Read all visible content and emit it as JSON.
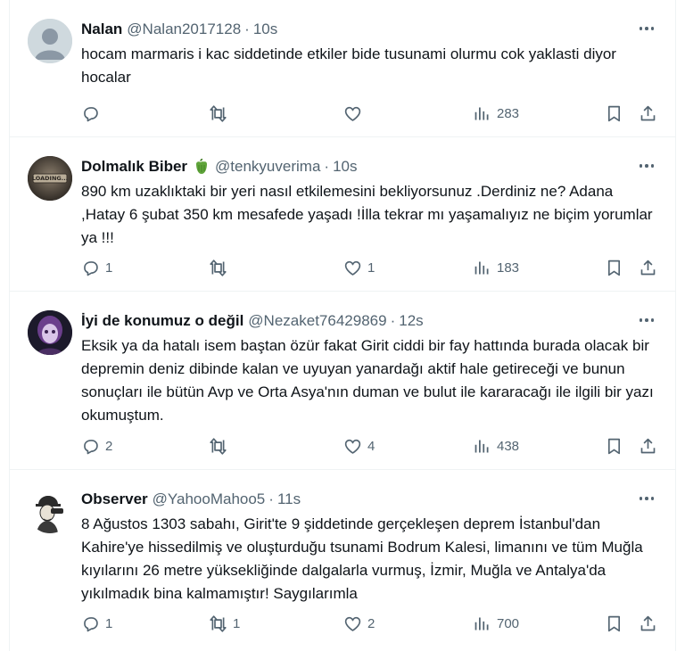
{
  "tweets": [
    {
      "name": "Nalan",
      "handle": "@Nalan2017128",
      "separator": "·",
      "time": "10s",
      "badge_emoji": "",
      "text": "hocam marmaris i kac siddetinde etkiler bide  tusunami olurmu cok yaklasti diyor hocalar",
      "replies": "",
      "retweets": "",
      "likes": "",
      "views": "283"
    },
    {
      "name": "Dolmalık Biber",
      "handle": "@tenkyuverima",
      "separator": "·",
      "time": "10s",
      "badge_emoji": "bell-pepper",
      "avatar_text": "LOADING...",
      "text": "890 km uzaklıktaki bir yeri nasıl etkilemesini bekliyorsunuz .Derdiniz ne? Adana ,Hatay 6 şubat 350 km mesafede yaşadı !İlla tekrar mı yaşamalıyız ne biçim yorumlar ya !!!",
      "replies": "1",
      "retweets": "",
      "likes": "1",
      "views": "183"
    },
    {
      "name": "İyi de konumuz o değil",
      "handle": "@Nezaket76429869",
      "separator": "·",
      "time": "12s",
      "badge_emoji": "",
      "text": "Eksik ya da hatalı isem baştan özür fakat Girit ciddi bir fay hattında burada olacak bir depremin deniz dibinde kalan ve uyuyan yanardağı aktif hale getireceği ve bunun sonuçları ile bütün Avp ve Orta Asya'nın duman ve bulut ile kararacağı ile ilgili bir yazı okumuştum.",
      "replies": "2",
      "retweets": "",
      "likes": "4",
      "views": "438"
    },
    {
      "name": "Observer",
      "handle": "@YahooMahoo5",
      "separator": "·",
      "time": "11s",
      "badge_emoji": "",
      "text": "8 Ağustos 1303 sabahı, Girit'te 9 şiddetinde gerçekleşen deprem İstanbul'dan Kahire'ye hissedilmiş ve oluşturduğu tsunami Bodrum Kalesi, limanını ve tüm Muğla kıyılarını 26 metre yüksekliğinde dalgalarla vurmuş, İzmir, Muğla ve Antalya'da yıkılmadık bina kalmamıştır! Saygılarımla",
      "replies": "1",
      "retweets": "1",
      "likes": "2",
      "views": "700"
    }
  ],
  "colors": {
    "text": "#0f1419",
    "secondary": "#536471",
    "border": "#eff3f4"
  },
  "icons": [
    "more-icon",
    "reply-icon",
    "retweet-icon",
    "like-icon",
    "views-icon",
    "bookmark-icon",
    "share-icon"
  ]
}
